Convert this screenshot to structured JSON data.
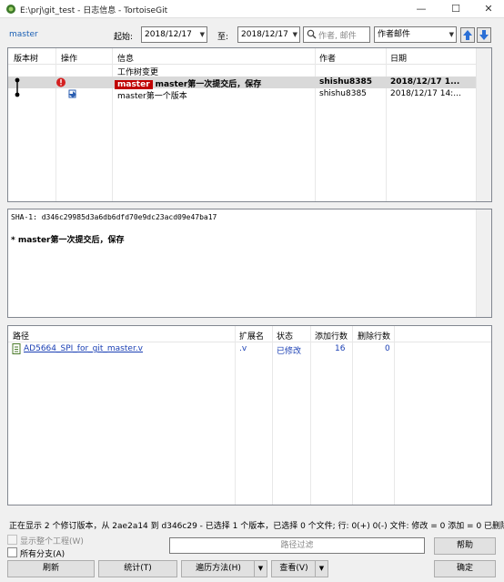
{
  "window": {
    "title": "E:\\prj\\git_test - 日志信息 - TortoiseGit",
    "minimize": "—",
    "maximize": "☐",
    "close": "✕"
  },
  "toolbar": {
    "branch": "master",
    "from_label": "起始:",
    "from_date": "2018/12/17",
    "to_label": "至:",
    "to_date": "2018/12/17",
    "search_placeholder": "作者, 邮件",
    "filter_field": "作者邮件"
  },
  "log": {
    "columns": [
      "版本树",
      "操作",
      "信息",
      "作者",
      "日期"
    ],
    "rows": [
      {
        "message": "工作树变更",
        "author": "",
        "date": "",
        "tag": "",
        "selected": false
      },
      {
        "message": "master第一次提交后，保存",
        "author": "shishu8385",
        "date": "2018/12/17 1...",
        "tag": "master",
        "selected": true
      },
      {
        "message": "master第一个版本",
        "author": "shishu8385",
        "date": "2018/12/17 14:...",
        "tag": "",
        "selected": false
      }
    ]
  },
  "detail": {
    "sha": "SHA-1: d346c29985d3a6db6dfd70e9dc23acd09e47ba17",
    "message": "* master第一次提交后，保存"
  },
  "files": {
    "columns": [
      "路径",
      "扩展名",
      "状态",
      "添加行数",
      "删除行数"
    ],
    "rows": [
      {
        "path": "AD5664_SPI_for_git_master.v",
        "ext": ".v",
        "status": "已修改",
        "added": "16",
        "deleted": "0"
      }
    ]
  },
  "status_text": "正在显示 2 个修订版本，从 2ae2a14 到 d346c29 - 已选择 1 个版本，已选择 0 个文件; 行: 0(+) 0(-) 文件: 修改 = 0 添加 = 0 已删除 =",
  "options": {
    "show_whole_project": "显示整个工程(W)",
    "all_branches": "所有分支(A)"
  },
  "path_filter": "路径过滤",
  "buttons": {
    "help": "帮助",
    "refresh": "刷新",
    "stats": "统计(T)",
    "walk": "遍历方法(H)",
    "view": "查看(V)",
    "ok": "确定"
  },
  "colors": {
    "link": "#1a5fb4",
    "master_tag": "#c00000",
    "selection": "#d9d9d9"
  },
  "icons": {
    "app": "tortoisegit-icon",
    "search": "search-icon",
    "back": "back-arrow-icon",
    "forward": "forward-arrow-icon",
    "file": "text-file-icon"
  }
}
